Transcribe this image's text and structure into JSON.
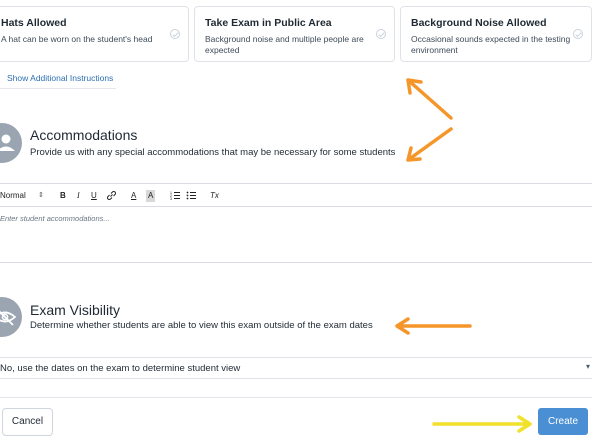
{
  "cards": [
    {
      "title": "Hats Allowed",
      "description": "A hat can be worn on the student's head"
    },
    {
      "title": "Take Exam in Public Area",
      "description": "Background noise and multiple people are expected"
    },
    {
      "title": "Background Noise Allowed",
      "description": "Occasional sounds expected in the testing environment"
    }
  ],
  "show_instructions_label": "Show Additional Instructions",
  "accommodations": {
    "title": "Accommodations",
    "subtitle": "Provide us with any special accommodations that may be necessary for some students",
    "toolbar": {
      "format": "Normal",
      "bold": "B",
      "italic": "I",
      "underline": "U",
      "font_color": "A",
      "highlight": "A",
      "clear": "Tx"
    },
    "placeholder": "Enter student accommodations..."
  },
  "visibility": {
    "title": "Exam Visibility",
    "subtitle": "Determine whether students are able to view this exam outside of the exam dates",
    "selected_option": "No, use the dates on the exam to determine student view"
  },
  "buttons": {
    "cancel": "Cancel",
    "create": "Create"
  },
  "icons": {
    "check": "check-circle-icon",
    "avatar_accommodations": "person-icon",
    "avatar_visibility": "eye-slash-icon",
    "select_arrow": "chevron-down-icon"
  },
  "colors": {
    "primary_button": "#4a8fd4",
    "link": "#2d6fb3",
    "avatar": "#9aa5b1",
    "annotation_orange": "#f5962a",
    "annotation_yellow": "#f2e12b"
  }
}
